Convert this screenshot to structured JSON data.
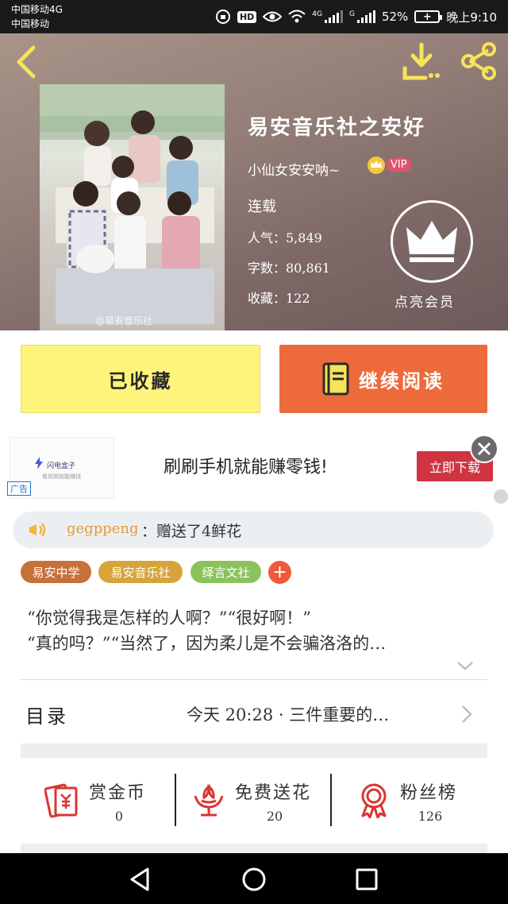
{
  "status_bar": {
    "carrier_1": "中国移动4G",
    "carrier_2": "中国移动",
    "net_4g": "4G",
    "net_g": "G",
    "battery": "52%",
    "time": "晚上9:10",
    "icons": [
      "rotation-lock-icon",
      "hd-icon",
      "eye-icon",
      "wifi-icon",
      "signal-icon",
      "battery-icon"
    ]
  },
  "header": {
    "book_title": "易安音乐社之安好",
    "author": "小仙女安安呐~",
    "vip_label": "VIP",
    "status": "连载",
    "stats": {
      "popularity": "人气：5,849",
      "word_count": "字数：80,861",
      "favorites": "收藏：122"
    },
    "member_label": "点亮会员",
    "cover_watermark": "@易安音乐社"
  },
  "actions": {
    "favorited_label": "已收藏",
    "continue_label": "继续阅读"
  },
  "ad": {
    "brand": "闪电盒子",
    "brand_sub": "看视频就能赚钱",
    "tag": "广告",
    "text": "刷刷手机就能赚零钱!",
    "cta": "立即下载"
  },
  "gift": {
    "user": "gegppeng",
    "text": "：赠送了4鲜花"
  },
  "tags": [
    "易安中学",
    "易安音乐社",
    "绎言文社"
  ],
  "tag_add": "+",
  "synopsis": {
    "line1": "“你觉得我是怎样的人啊？”“很好啊！”",
    "line2": "“真的吗？”“当然了，因为柔儿是不会骗洛洛的…"
  },
  "catalog": {
    "label": "目录",
    "latest": "今天 20:28 · 三件重要的…"
  },
  "bottom_stats": {
    "reward": {
      "title": "赏金币",
      "value": "0"
    },
    "flowers": {
      "title": "免费送花",
      "value": "20"
    },
    "fans": {
      "title": "粉丝榜",
      "value": "126"
    }
  },
  "colors": {
    "favorite_button": "#fef47c",
    "read_button": "#ed6a3b",
    "accent_red": "#d8362f",
    "tag_1": "#c6703a",
    "tag_2": "#d6a43a",
    "tag_3": "#8cc25c",
    "gift_user": "#e39a3b"
  }
}
